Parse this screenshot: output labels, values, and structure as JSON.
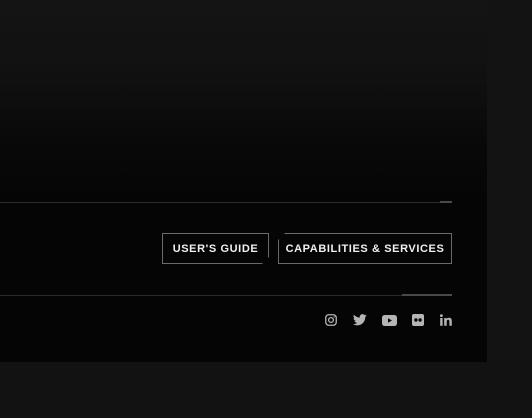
{
  "footer": {
    "buttons": {
      "users_guide": "USER'S GUIDE",
      "capabilities": "CAPABILITIES & SERVICES"
    },
    "social_icons": [
      "instagram-icon",
      "twitter-icon",
      "youtube-icon",
      "flickr-icon",
      "linkedin-icon"
    ],
    "colors": {
      "panel_bg": "#050505",
      "page_bg": "#141414",
      "button_text": "#f0f0f0",
      "button_border": "#6a6a6a",
      "icon": "#b5b5b5",
      "divider": "#2b2b2b"
    }
  }
}
